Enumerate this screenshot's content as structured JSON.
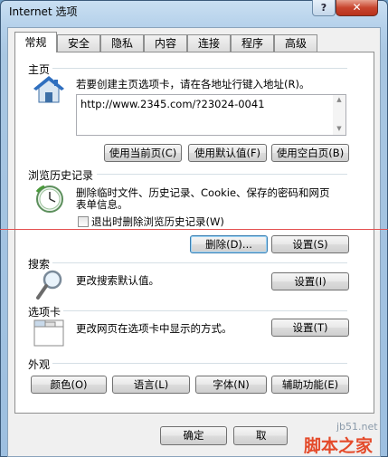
{
  "window": {
    "title": "Internet 选项",
    "help_label": "?",
    "close_label": "✕"
  },
  "tabs": [
    {
      "label": "常规",
      "active": true
    },
    {
      "label": "安全"
    },
    {
      "label": "隐私"
    },
    {
      "label": "内容"
    },
    {
      "label": "连接"
    },
    {
      "label": "程序"
    },
    {
      "label": "高级"
    }
  ],
  "home": {
    "label": "主页",
    "description": "若要创建主页选项卡，请在各地址行键入地址(R)。",
    "url": "http://www.2345.com/?23024-0041",
    "buttons": {
      "use_current": "使用当前页(C)",
      "use_default": "使用默认值(F)",
      "use_blank": "使用空白页(B)"
    }
  },
  "history": {
    "label": "浏览历史记录",
    "description_line1": "删除临时文件、历史记录、Cookie、保存的密码和网页",
    "description_line2": "表单信息。",
    "checkbox_label": "退出时删除浏览历史记录(W)",
    "checkbox_checked": false,
    "delete_button": "删除(D)...",
    "settings_button": "设置(S)"
  },
  "search": {
    "label": "搜索",
    "description": "更改搜索默认值。",
    "settings_button": "设置(I)"
  },
  "tabs_section": {
    "label": "选项卡",
    "description": "更改网页在选项卡中显示的方式。",
    "settings_button": "设置(T)"
  },
  "appearance": {
    "label": "外观",
    "buttons": {
      "colors": "颜色(O)",
      "languages": "语言(L)",
      "fonts": "字体(N)",
      "accessibility": "辅助功能(E)"
    }
  },
  "footer": {
    "ok_button": "确定",
    "cancel_button": "取"
  },
  "watermark": {
    "site": "jb51.net",
    "brand": "脚本之家"
  },
  "colors": {
    "accent_red_line": "#e45050",
    "close_button": "#c8452e"
  }
}
